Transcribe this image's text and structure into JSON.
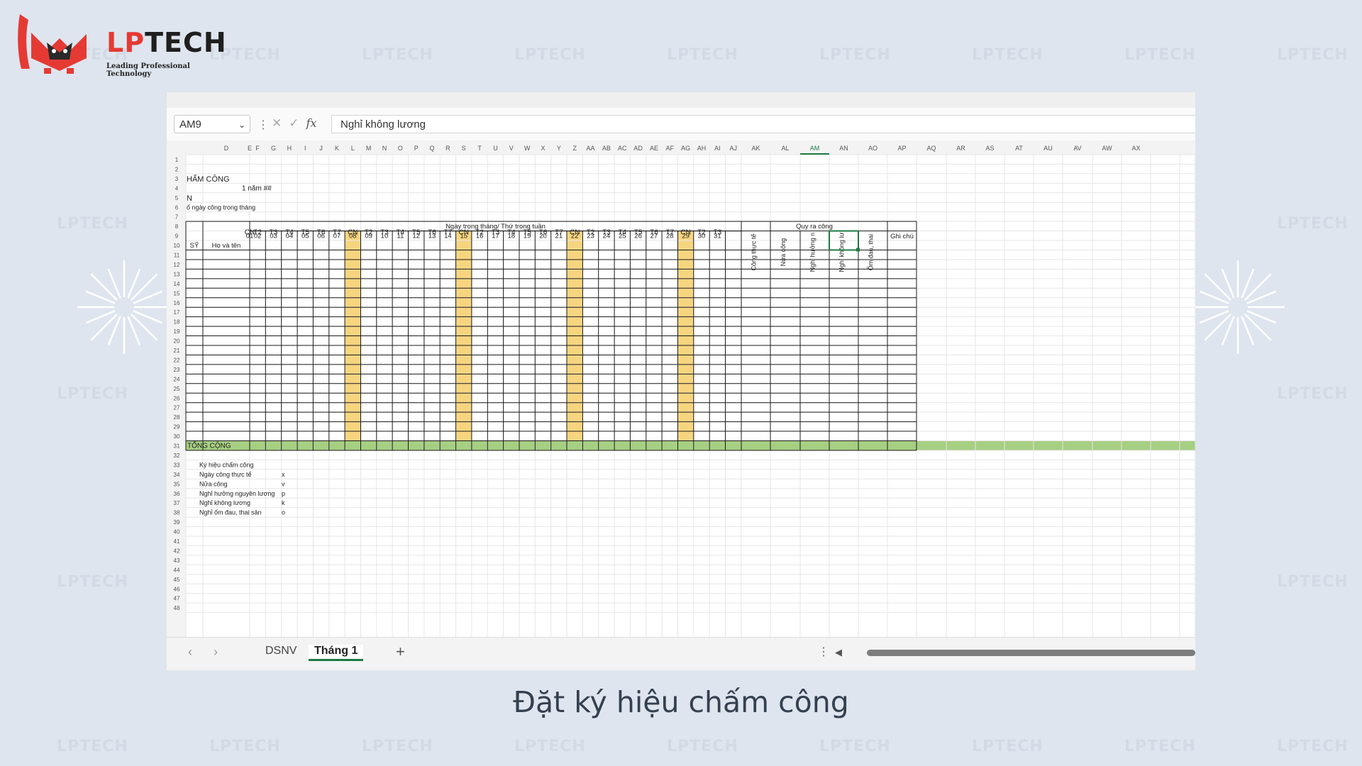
{
  "brand": {
    "name_part1": "LP",
    "name_part2": "TECH",
    "tagline": "Leading Professional Technology",
    "watermark": "LPTECH",
    "accent": "#e53a34"
  },
  "formula_bar": {
    "name_box": "AM9",
    "formula": "Nghỉ không lương"
  },
  "sheet": {
    "column_letters": [
      "D",
      "E",
      "F",
      "G",
      "H",
      "I",
      "J",
      "K",
      "L",
      "M",
      "N",
      "O",
      "P",
      "Q",
      "R",
      "S",
      "T",
      "U",
      "V",
      "W",
      "X",
      "Y",
      "Z",
      "AA",
      "AB",
      "AC",
      "AD",
      "AE",
      "AF",
      "AG",
      "AH",
      "AI",
      "AJ",
      "AK",
      "AL",
      "AM",
      "AN",
      "AO",
      "AP",
      "AQ",
      "AR",
      "AS",
      "AT",
      "AU",
      "AV",
      "AW",
      "AX"
    ],
    "title": "HẤM CÔNG",
    "subtitle": "1 năm ##",
    "row5": "N",
    "row6": "ố ngày công trong tháng",
    "group_days": "Ngày trong tháng/ Thứ trong tuần",
    "group_summary": "Quy ra công",
    "col_stt": "SỸ",
    "col_name": "Họ và tên",
    "days": [
      "01",
      "02",
      "03",
      "04",
      "05",
      "06",
      "07",
      "08",
      "09",
      "10",
      "11",
      "12",
      "13",
      "14",
      "15",
      "16",
      "17",
      "18",
      "19",
      "20",
      "21",
      "22",
      "23",
      "24",
      "25",
      "26",
      "27",
      "28",
      "29",
      "30",
      "31"
    ],
    "weekdays": [
      "CN",
      "T2",
      "T3",
      "T4",
      "T5",
      "T6",
      "T7",
      "CN",
      "T2",
      "T3",
      "T4",
      "T5",
      "T6",
      "T7",
      "CN",
      "T2",
      "T3",
      "T4",
      "T5",
      "T6",
      "T7",
      "CN",
      "T2",
      "T3",
      "T4",
      "T5",
      "T6",
      "T7",
      "CN",
      "T2",
      "T3"
    ],
    "summary_cols": [
      "Công thực tế",
      "Nửa công",
      "Nghỉ hưởng n",
      "Nghỉ không lư",
      "Ốm đau, thai"
    ],
    "note_col": "Ghi chú",
    "total_label": "TỔNG CỘNG",
    "legend": [
      {
        "label": "Ký hiệu chấm công",
        "symbol": ""
      },
      {
        "label": "Ngày công thực tế",
        "symbol": "x"
      },
      {
        "label": "Nửa công",
        "symbol": "v"
      },
      {
        "label": "Nghỉ hưởng nguyên lương",
        "symbol": "p"
      },
      {
        "label": "Nghỉ không lương",
        "symbol": "k"
      },
      {
        "label": "Nghỉ ốm đau, thai sản",
        "symbol": "o"
      }
    ],
    "colors": {
      "sunday": "#f7d57f",
      "total": "#a6cf82",
      "selected": "#1f7a45"
    }
  },
  "tabs": {
    "items": [
      "DSNV",
      "Tháng 1"
    ],
    "active": "Tháng 1",
    "prev": "‹",
    "next": "›",
    "add": "+"
  },
  "caption": "Đặt ký hiệu chấm công"
}
